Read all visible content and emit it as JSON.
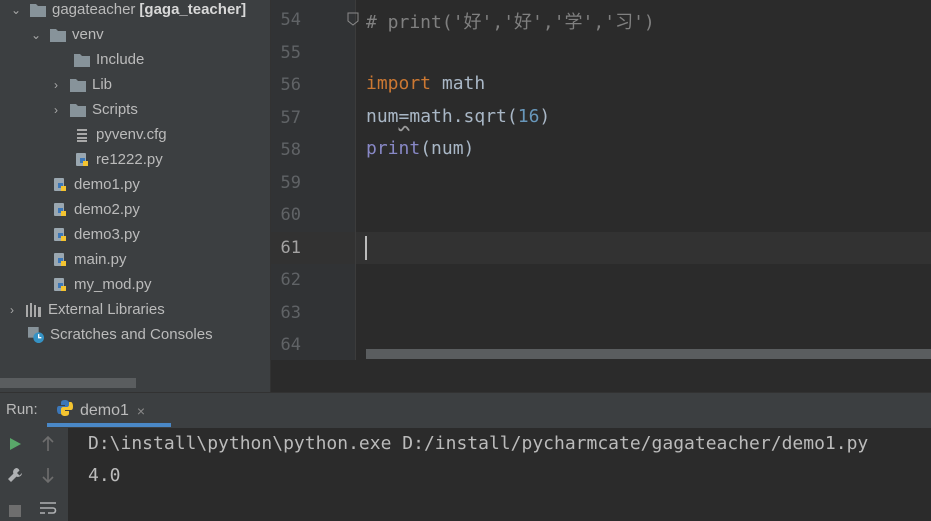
{
  "project_tree": {
    "root": {
      "name": "gagateacher",
      "module": "[gaga_teacher]"
    },
    "venv": "venv",
    "include": "Include",
    "lib": "Lib",
    "scripts": "Scripts",
    "pyvenv": "pyvenv.cfg",
    "re1222": "re1222.py",
    "files": [
      "demo1.py",
      "demo2.py",
      "demo3.py",
      "main.py",
      "my_mod.py"
    ],
    "external_libraries": "External Libraries",
    "scratches": "Scratches and Consoles"
  },
  "editor": {
    "line_numbers": [
      "54",
      "55",
      "56",
      "57",
      "58",
      "59",
      "60",
      "61",
      "62",
      "63",
      "64"
    ],
    "active_line": "61",
    "code": {
      "line54": "# print('好','好','学','习')",
      "line56_kw": "import",
      "line56_rest": " math",
      "line57_a": "num",
      "line57_b": "=",
      "line57_c": "math.sqrt(",
      "line57_num": "16",
      "line57_d": ")",
      "line58_fn": "print",
      "line58_rest": "(num)"
    }
  },
  "run_panel": {
    "label": "Run:",
    "tab": "demo1",
    "close": "×",
    "output": [
      "D:\\install\\python\\python.exe D:/install/pycharmcate/gagateacher/demo1.py",
      "4.0"
    ]
  },
  "colors": {
    "keyword": "#cc7832",
    "number": "#6897bb",
    "builtin": "#8888c6",
    "comment": "#808080",
    "accent": "#4a88c7"
  }
}
